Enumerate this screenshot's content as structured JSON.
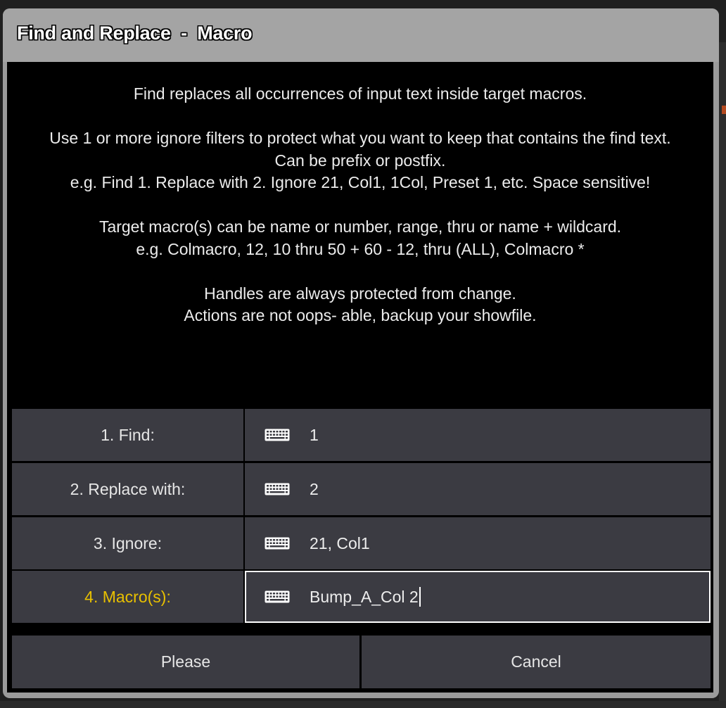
{
  "dialog": {
    "title": "Find and Replace  -  Macro"
  },
  "info": {
    "line1": "Find replaces all occurrences of input text inside target macros.",
    "line2": "Use 1 or more ignore filters to protect what you want to keep that contains the find text.",
    "line3": "Can be prefix or postfix.",
    "line4": "e.g. Find 1. Replace with 2. Ignore 21, Col1, 1Col, Preset 1, etc. Space sensitive!",
    "line5": "Target macro(s) can be name or number, range, thru or name + wildcard.",
    "line6": "e.g. Colmacro, 12, 10 thru 50 + 60  -  12, thru (ALL), Colmacro *",
    "line7": "Handles are always protected from change.",
    "line8": "Actions are not oops- able, backup your showfile."
  },
  "form": {
    "rows": [
      {
        "label": "1. Find:",
        "value": "1",
        "icon": "keyboard-icon"
      },
      {
        "label": "2. Replace with:",
        "value": "2",
        "icon": "keyboard-icon"
      },
      {
        "label": "3. Ignore:",
        "value": "21, Col1",
        "icon": "keyboard-icon"
      },
      {
        "label": "4. Macro(s):",
        "value": "Bump_A_Col 2",
        "icon": "keyboard-icon"
      }
    ],
    "active_row": 3
  },
  "buttons": {
    "please": "Please",
    "cancel": "Cancel"
  },
  "colors": {
    "active_label": "#e8c000",
    "cell_bg": "#3b3b42",
    "title_bar": "#a4a4a4"
  }
}
